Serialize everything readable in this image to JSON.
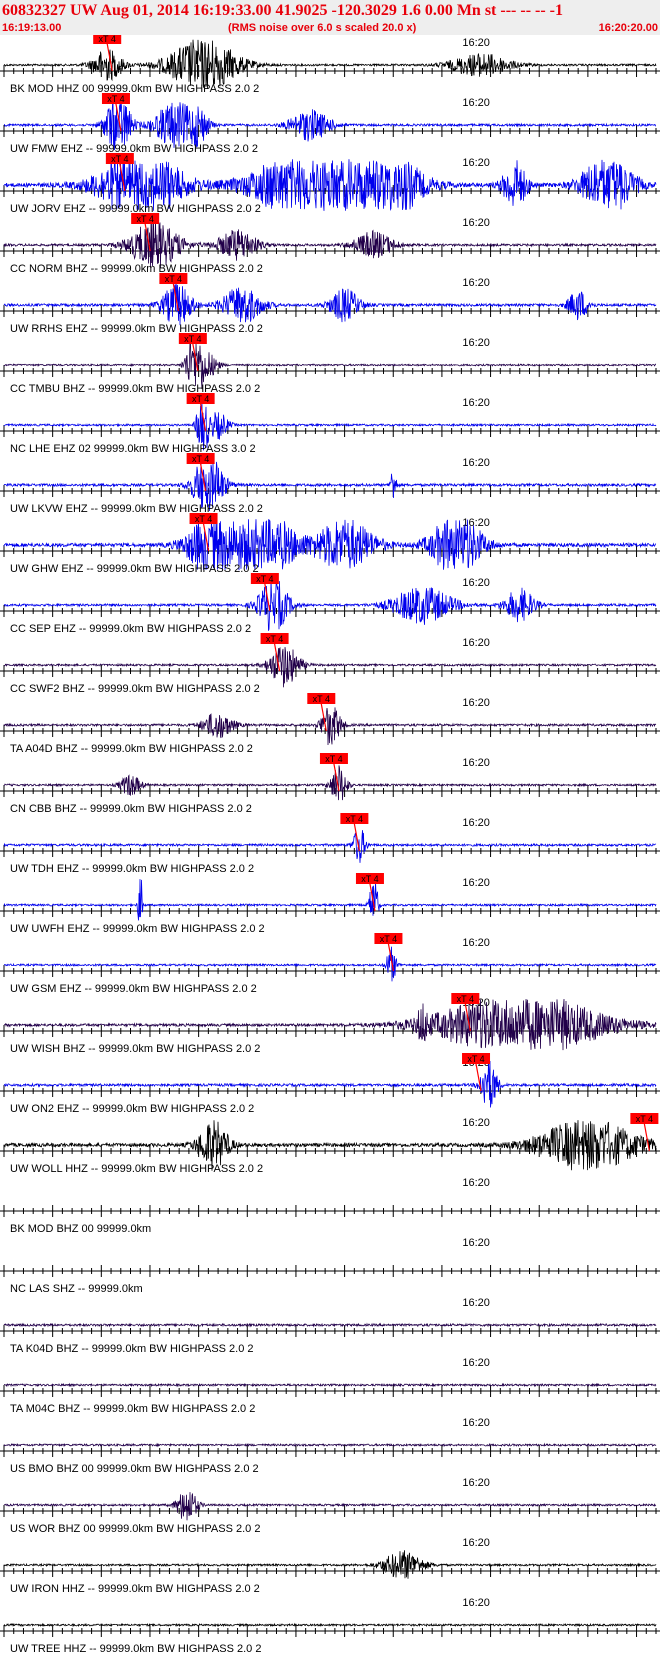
{
  "header": {
    "title": "60832327 UW Aug 01, 2014 16:19:33.00   41.9025 -120.3029  1.6 0.00 Mn st --- -- --  -1",
    "start_time": "16:19:13.00",
    "note": "(RMS noise over 6.0 s scaled 20.0 x)",
    "end_time": "16:20:20.00"
  },
  "colors": {
    "header_text": "#e8000b",
    "pick": "#ff0000",
    "axis": "#000000"
  },
  "chart_data": {
    "type": "line",
    "time_axis": {
      "start": "16:19:13.00",
      "end": "16:20:20.00",
      "minute_label": "16:20",
      "minute_offset_s": 47
    },
    "pick_label": "xT 4",
    "traces": [
      {
        "label": "BK MOD HHZ 00 99999.0km BW  HIGHPASS  2.0  2",
        "color": "#000000",
        "amp": 0.3,
        "pick_s": 10.4,
        "bursts": [
          [
            20.5,
            3.5,
            3.0
          ],
          [
            10.6,
            1.5,
            1.8
          ],
          [
            49.0,
            3.0,
            1.3
          ]
        ]
      },
      {
        "label": "UW FMW EHZ -- 99999.0km BW  HIGHPASS  2.0  2",
        "color": "#0000ee",
        "amp": 0.35,
        "pick_s": 11.3,
        "bursts": [
          [
            11.7,
            1.2,
            3.5
          ],
          [
            17.5,
            2.0,
            2.2
          ],
          [
            20.0,
            1.0,
            1.6
          ],
          [
            31.5,
            2.0,
            1.5
          ]
        ]
      },
      {
        "label": "UW JORV EHZ -- 99999.0km BW  HIGHPASS  2.0  2",
        "color": "#0000ee",
        "amp": 0.6,
        "pick_s": 11.7,
        "bursts": [
          [
            14.0,
            4.0,
            2.2
          ],
          [
            33.0,
            6.0,
            3.2
          ],
          [
            38.0,
            4.0,
            2.0
          ],
          [
            52.5,
            1.2,
            1.4
          ],
          [
            62.0,
            2.5,
            1.8
          ]
        ]
      },
      {
        "label": "CC NORM BHZ -- 99999.0km BW  HIGHPASS  2.0  2",
        "color": "#22004a",
        "amp": 0.35,
        "pick_s": 14.3,
        "bursts": [
          [
            15.5,
            2.5,
            2.3
          ],
          [
            24.0,
            2.0,
            1.5
          ],
          [
            38.0,
            2.0,
            1.3
          ]
        ]
      },
      {
        "label": "UW RRHS EHZ -- 99999.0km BW  HIGHPASS  2.0  2",
        "color": "#0000ee",
        "amp": 0.4,
        "pick_s": 17.2,
        "bursts": [
          [
            17.8,
            1.5,
            1.8
          ],
          [
            24.5,
            2.0,
            1.6
          ],
          [
            35.0,
            1.5,
            1.4
          ],
          [
            59.0,
            1.0,
            1.3
          ]
        ]
      },
      {
        "label": "CC TMBU BHZ -- 99999.0km BW  HIGHPASS  2.0  2",
        "color": "#22004a",
        "amp": 0.25,
        "pick_s": 19.2,
        "bursts": [
          [
            19.6,
            0.8,
            5.5
          ],
          [
            21.0,
            1.0,
            1.6
          ]
        ]
      },
      {
        "label": "NC LHE EHZ 02 99999.0km BW  HIGHPASS  3.0  2",
        "color": "#0000ee",
        "amp": 0.3,
        "pick_s": 20.0,
        "bursts": [
          [
            20.4,
            0.5,
            5.0
          ],
          [
            22.0,
            1.0,
            1.5
          ]
        ]
      },
      {
        "label": "UW LKVW EHZ -- 99999.0km BW  HIGHPASS  2.0  2",
        "color": "#0000ee",
        "amp": 0.4,
        "pick_s": 20.0,
        "bursts": [
          [
            21.0,
            1.5,
            2.8
          ],
          [
            40.0,
            0.3,
            1.5
          ]
        ]
      },
      {
        "label": "UW GHW EHZ -- 99999.0km BW  HIGHPASS  2.0  2",
        "color": "#0000ee",
        "amp": 0.55,
        "pick_s": 20.3,
        "bursts": [
          [
            21.5,
            2.5,
            2.2
          ],
          [
            27.0,
            3.0,
            1.9
          ],
          [
            35.0,
            3.0,
            1.6
          ],
          [
            46.5,
            2.5,
            2.0
          ]
        ]
      },
      {
        "label": "CC SEP EHZ -- 99999.0km BW  HIGHPASS  2.0  2",
        "color": "#0000ee",
        "amp": 0.35,
        "pick_s": 26.6,
        "bursts": [
          [
            27.7,
            1.5,
            2.6
          ],
          [
            43.0,
            3.0,
            1.8
          ],
          [
            53.0,
            1.5,
            1.6
          ]
        ]
      },
      {
        "label": "CC SWF2 BHZ -- 99999.0km BW  HIGHPASS  2.0  2",
        "color": "#22004a",
        "amp": 0.3,
        "pick_s": 27.6,
        "bursts": [
          [
            28.8,
            1.5,
            2.4
          ]
        ]
      },
      {
        "label": "TA A04D BHZ -- 99999.0km BW  HIGHPASS  2.0  2",
        "color": "#22004a",
        "amp": 0.35,
        "pick_s": 32.4,
        "bursts": [
          [
            33.6,
            1.0,
            2.0
          ],
          [
            22.0,
            1.5,
            1.3
          ]
        ]
      },
      {
        "label": "CN CBB BHZ -- 99999.0km BW  HIGHPASS  2.0  2",
        "color": "#22004a",
        "amp": 0.3,
        "pick_s": 33.7,
        "bursts": [
          [
            34.4,
            0.8,
            2.2
          ],
          [
            13.0,
            1.0,
            1.3
          ]
        ]
      },
      {
        "label": "UW TDH EHZ -- 99999.0km BW  HIGHPASS  2.0  2",
        "color": "#0000ee",
        "amp": 0.35,
        "pick_s": 35.8,
        "bursts": [
          [
            36.5,
            0.6,
            1.8
          ]
        ]
      },
      {
        "label": "UW UWFH EHZ -- 99999.0km BW  HIGHPASS  2.0  2",
        "color": "#0000ee",
        "amp": 0.3,
        "pick_s": 37.4,
        "bursts": [
          [
            14.0,
            0.2,
            5.0
          ],
          [
            38.0,
            0.4,
            3.5
          ]
        ]
      },
      {
        "label": "UW GSM EHZ -- 99999.0km BW  HIGHPASS  2.0  2",
        "color": "#0000ee",
        "amp": 0.3,
        "pick_s": 39.3,
        "bursts": [
          [
            39.8,
            0.5,
            2.0
          ]
        ]
      },
      {
        "label": "UW WISH BHZ -- 99999.0km BW  HIGHPASS  2.0  2",
        "color": "#22004a",
        "amp": 0.4,
        "pick_s": 47.2,
        "bursts": [
          [
            53.0,
            8.0,
            2.8
          ],
          [
            43.0,
            0.5,
            1.3
          ]
        ]
      },
      {
        "label": "UW ON2 EHZ -- 99999.0km BW  HIGHPASS  2.0  2",
        "color": "#0000ee",
        "amp": 0.4,
        "pick_s": 48.3,
        "bursts": [
          [
            49.8,
            0.8,
            2.5
          ]
        ]
      },
      {
        "label": "UW WOLL HHZ -- 99999.0km BW  HIGHPASS  2.0  2",
        "color": "#000000",
        "amp": 0.55,
        "pick_s": 65.6,
        "bursts": [
          [
            21.5,
            1.5,
            1.5
          ],
          [
            60.0,
            5.0,
            1.6
          ]
        ]
      },
      {
        "label": "BK MOD BHZ 00 99999.0km",
        "color": "#000000",
        "amp": 0.0,
        "pick_s": null,
        "bursts": []
      },
      {
        "label": "NC LAS SHZ -- 99999.0km",
        "color": "#000000",
        "amp": 0.0,
        "pick_s": null,
        "bursts": []
      },
      {
        "label": "TA K04D BHZ -- 99999.0km BW  HIGHPASS  2.0  2",
        "color": "#22004a",
        "amp": 0.35,
        "pick_s": null,
        "bursts": []
      },
      {
        "label": "TA M04C BHZ -- 99999.0km BW  HIGHPASS  2.0  2",
        "color": "#22004a",
        "amp": 0.3,
        "pick_s": null,
        "bursts": []
      },
      {
        "label": "US BMO BHZ 00 99999.0km BW  HIGHPASS  2.0  2",
        "color": "#22004a",
        "amp": 0.3,
        "pick_s": null,
        "bursts": []
      },
      {
        "label": "US WOR BHZ 00 99999.0km BW  HIGHPASS  2.0  2",
        "color": "#22004a",
        "amp": 0.3,
        "pick_s": null,
        "bursts": [
          [
            18.8,
            1.0,
            2.0
          ]
        ]
      },
      {
        "label": "UW IRON HHZ -- 99999.0km BW  HIGHPASS  2.0  2",
        "color": "#000000",
        "amp": 0.3,
        "pick_s": null,
        "bursts": [
          [
            41.0,
            2.0,
            1.6
          ]
        ]
      },
      {
        "label": "UW TREE HHZ -- 99999.0km BW  HIGHPASS  2.0  2",
        "color": "#000000",
        "amp": 0.3,
        "pick_s": null,
        "bursts": []
      }
    ]
  }
}
